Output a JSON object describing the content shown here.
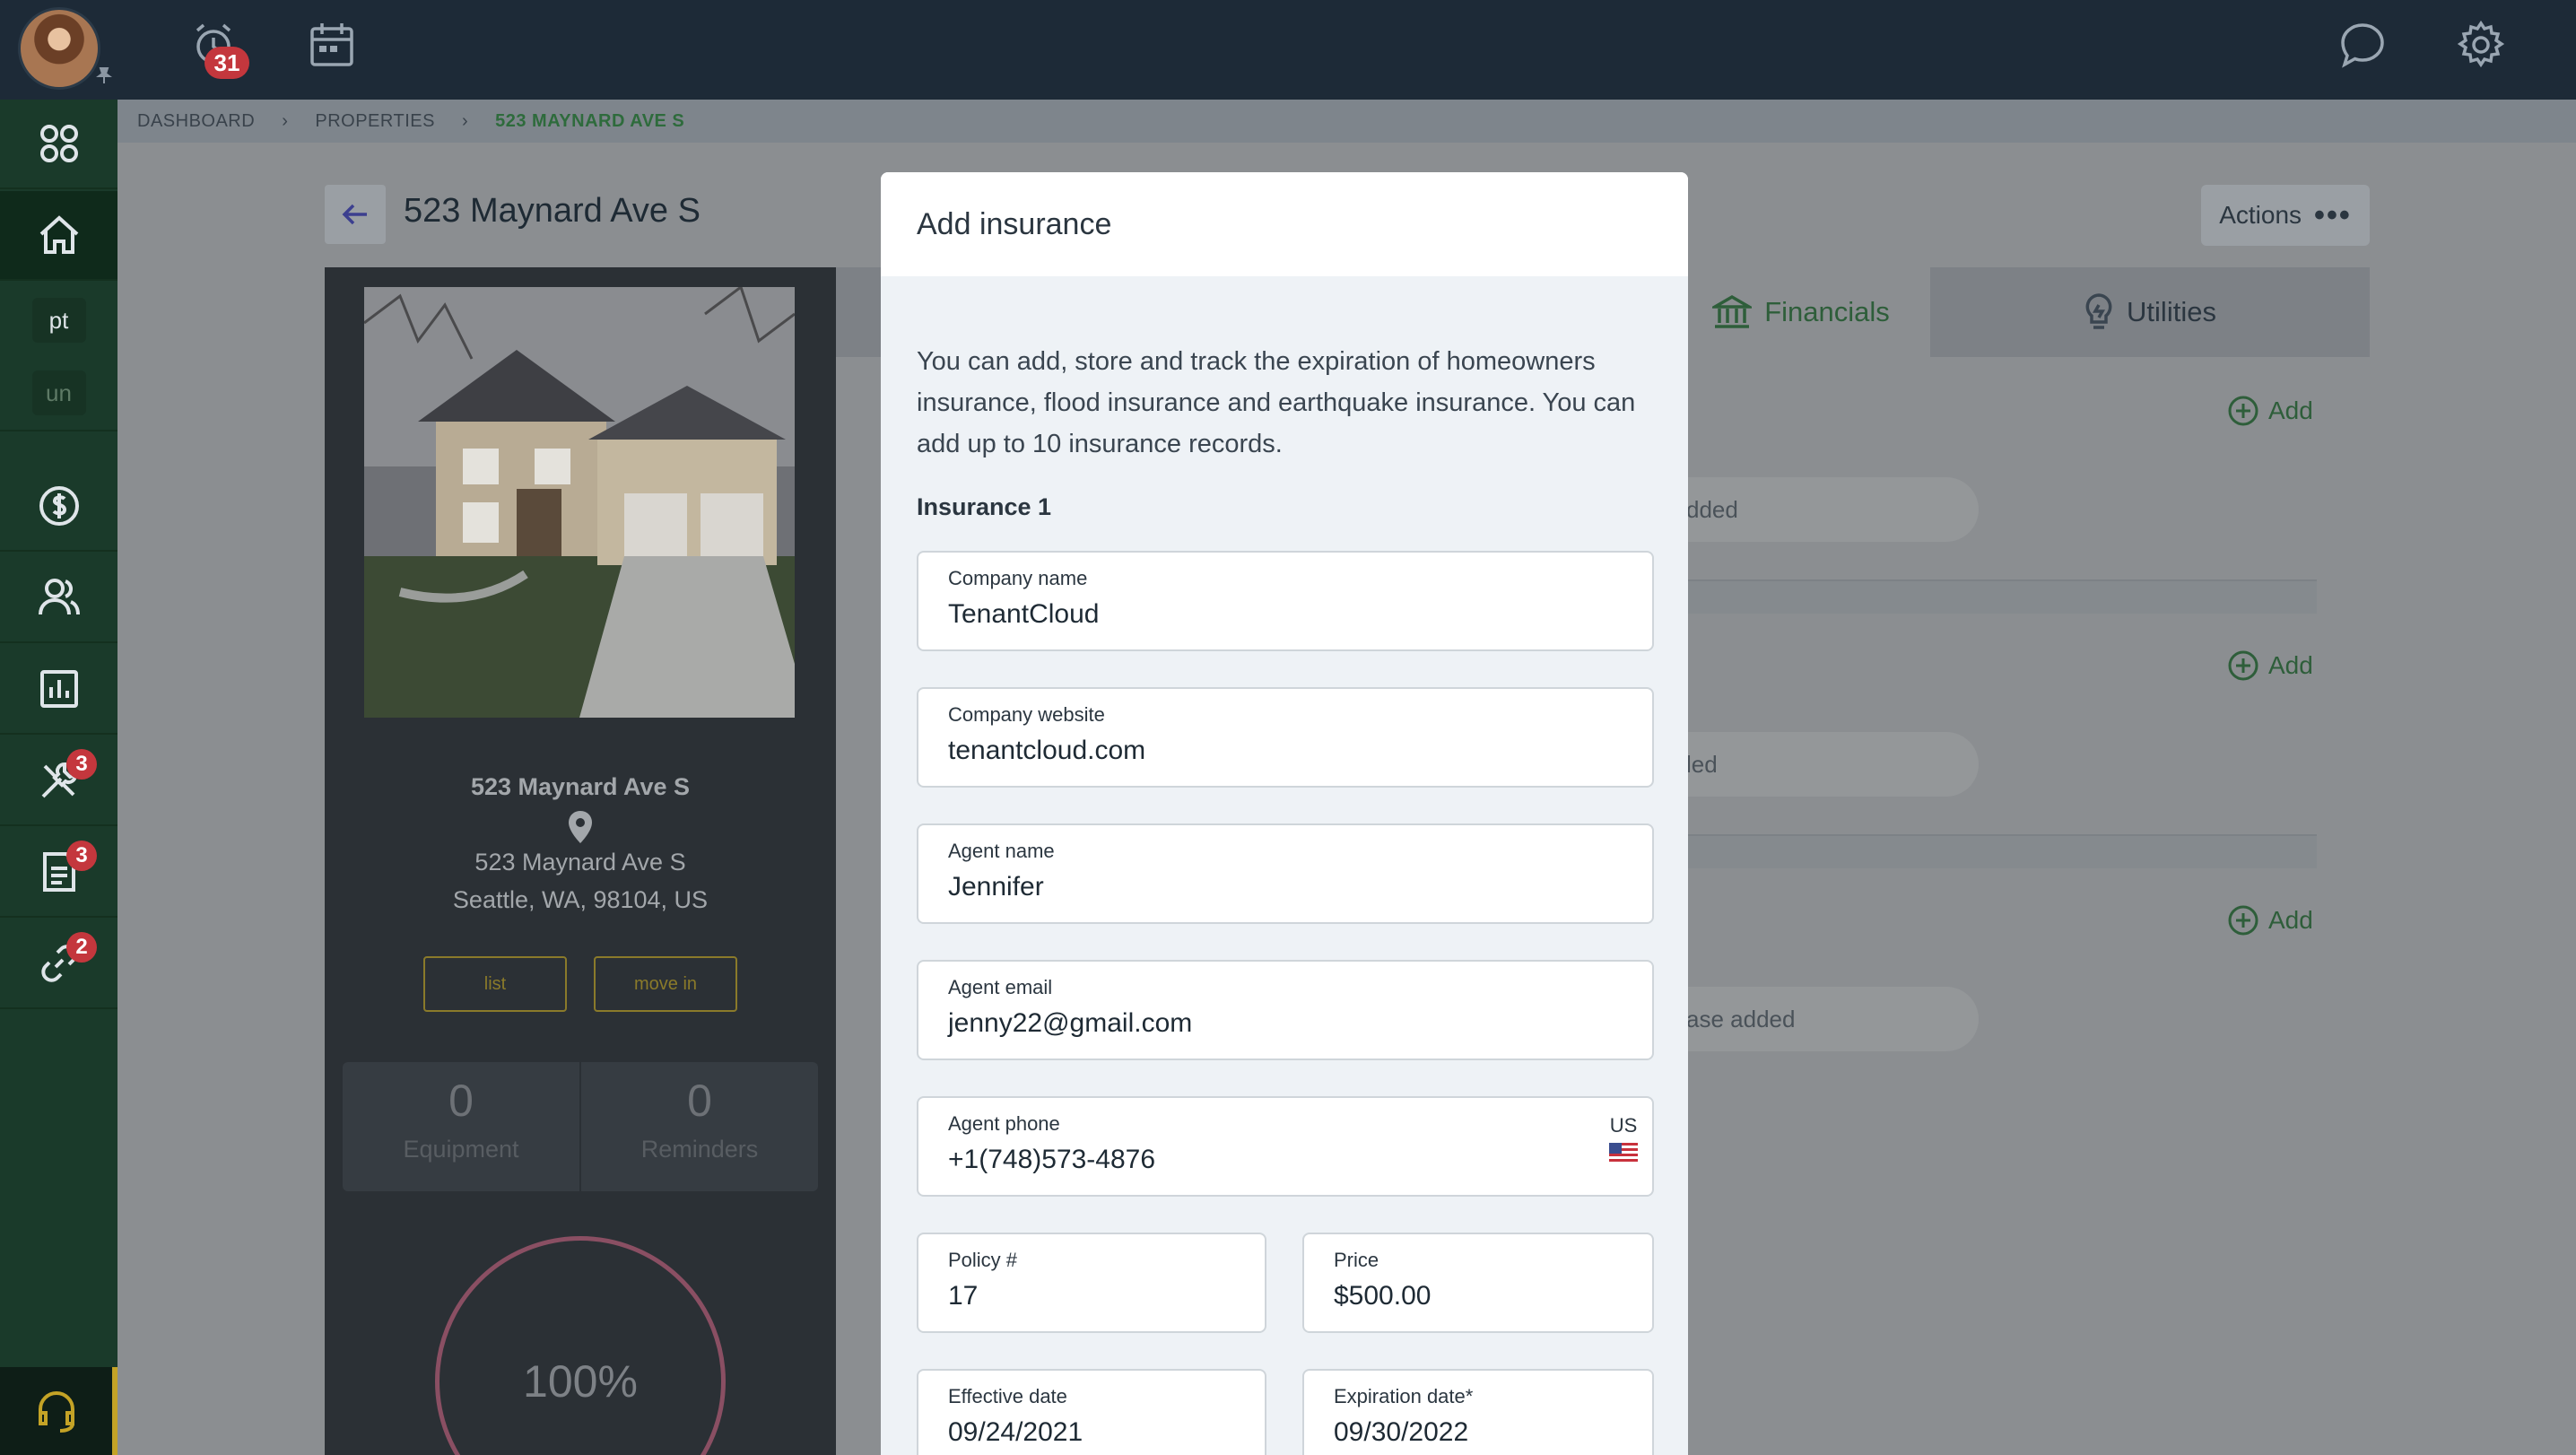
{
  "topbar": {
    "notification_count": "31",
    "icons": [
      "alarm-clock-icon",
      "calendar-icon",
      "chat-icon",
      "gear-icon"
    ]
  },
  "sidebar": {
    "items": [
      {
        "name": "apps-icon"
      },
      {
        "name": "home-icon",
        "active": true
      },
      {
        "text": "pt"
      },
      {
        "text": "un"
      },
      {
        "name": "dollar-icon"
      },
      {
        "name": "people-icon"
      },
      {
        "name": "chart-icon"
      },
      {
        "name": "tools-icon",
        "badge": "3"
      },
      {
        "name": "document-icon",
        "badge": "3"
      },
      {
        "name": "link-icon",
        "badge": "2"
      }
    ],
    "support_icon": "headset-icon"
  },
  "breadcrumb": {
    "items": [
      "DASHBOARD",
      "PROPERTIES"
    ],
    "current": "523 MAYNARD AVE S"
  },
  "page": {
    "title": "523 Maynard Ave S",
    "actions_label": "Actions"
  },
  "property": {
    "name": "523 Maynard Ave S",
    "address_line1": "523 Maynard Ave S",
    "address_line2": "Seattle, WA, 98104, US",
    "list_button": "list",
    "move_in_button": "move in",
    "equipment_count": "0",
    "equipment_label": "Equipment",
    "reminders_count": "0",
    "reminders_label": "Reminders",
    "completion": "100%"
  },
  "tabs": {
    "financials": "Financials",
    "utilities": "Utilities"
  },
  "sections": {
    "add_label": "Add",
    "pill1": "dded",
    "pill2": "led",
    "pill3": "ase added"
  },
  "modal": {
    "title": "Add insurance",
    "description": "You can add, store and track the expiration of homeowners insurance, flood insurance and earthquake insurance. You can add up to 10 insurance records.",
    "section_label": "Insurance 1",
    "fields": {
      "company_name": {
        "label": "Company name",
        "value": "TenantCloud"
      },
      "company_website": {
        "label": "Company website",
        "value": "tenantcloud.com"
      },
      "agent_name": {
        "label": "Agent name",
        "value": "Jennifer"
      },
      "agent_email": {
        "label": "Agent email",
        "value": "jenny22@gmail.com"
      },
      "agent_phone": {
        "label": "Agent phone",
        "value": "+1(748)573-4876",
        "country": "US"
      },
      "policy": {
        "label": "Policy #",
        "value": "17"
      },
      "price": {
        "label": "Price",
        "value": "$500.00"
      },
      "effective_date": {
        "label": "Effective date",
        "value": "09/24/2021"
      },
      "expiration_date": {
        "label": "Expiration date*",
        "value": "09/30/2022"
      }
    }
  },
  "colors": {
    "topbar": "#1d2a37",
    "sidebar": "#1a3a2a",
    "accent_green": "#2e5e3a",
    "badge_red": "#c4373d"
  }
}
